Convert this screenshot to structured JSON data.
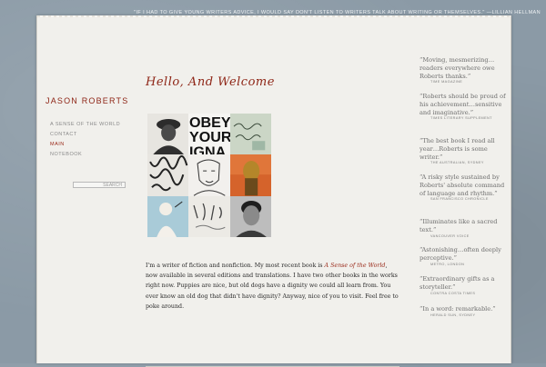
{
  "top_quote": "\"IF I HAD TO GIVE YOUNG WRITERS ADVICE, I WOULD SAY DON'T LISTEN TO WRITERS TALK ABOUT WRITING OR THEMSELVES.\" —LILLIAN HELLMAN",
  "site_title": "JASON ROBERTS",
  "nav": [
    {
      "label": "A SENSE OF THE WORLD",
      "active": false
    },
    {
      "label": "CONTACT",
      "active": false
    },
    {
      "label": "MAIN",
      "active": true
    },
    {
      "label": "NOTEBOOK",
      "active": false
    }
  ],
  "search": {
    "label": "SEARCH"
  },
  "heading": "Hello, And Welcome",
  "collage_text": {
    "obey": "OBEY",
    "your": "YOUR",
    "igna": "IGNA"
  },
  "bio": {
    "part1": "I'm a writer of fiction and nonfiction. My most recent book is ",
    "book_title": "A Sense of the World",
    "part2": ", now available in several editions and translations. I have two other books in the works right now. Puppies are nice, but old dogs have a dignity we could all learn from. You ever know an old dog that didn't have dignity? Anyway, nice of you to visit. Feel free to poke around."
  },
  "quotes": [
    {
      "text": "“Moving, mesmerizing… readers everywhere owe Roberts thanks.”",
      "source": "TIME MAGAZINE"
    },
    {
      "text": "“Roberts should be proud of his achievement…sensitive and imaginative.”",
      "source": "TIMES LITERARY SUPPLEMENT"
    },
    {
      "text": "“The best book I read all year…Roberts is some writer.”",
      "source": "THE AUSTRALIAN, SYDNEY"
    },
    {
      "text": "“A risky style sustained by Roberts' absolute command of language and rhythm.”",
      "source": "SAN FRANCISCO CHRONICLE"
    },
    {
      "text": "“Illuminates like a sacred text.”",
      "source": "VANCOUVER VOICE"
    },
    {
      "text": "“Astonishing…often deeply perceptive.”",
      "source": "METRO, LONDON"
    },
    {
      "text": "“Extraordinary gifts as a storyteller.”",
      "source": "CONTRA COSTA TIMES"
    },
    {
      "text": "“In a word: remarkable.”",
      "source": "HERALD SUN, SYDNEY"
    }
  ]
}
